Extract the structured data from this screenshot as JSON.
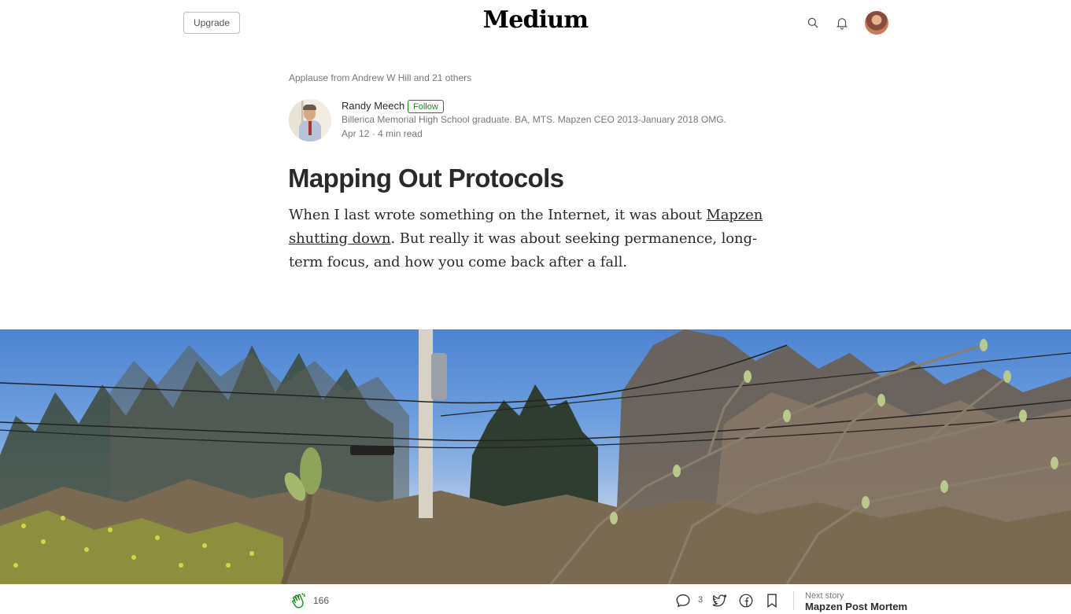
{
  "header": {
    "upgrade_label": "Upgrade",
    "logo_text": "Medium",
    "icons": [
      "search-icon",
      "bell-icon",
      "user-avatar"
    ]
  },
  "article": {
    "applause_text": "Applause from Andrew W Hill and 21 others",
    "author": {
      "name": "Randy Meech",
      "follow_label": "Follow",
      "bio": "Billerica Memorial High School graduate. BA, MTS. Mapzen CEO 2013-January 2018 OMG.",
      "date": "Apr 12",
      "separator": "·",
      "read_time": "4 min read"
    },
    "title": "Mapping Out Protocols",
    "body": {
      "part1": "When I last wrote something on the Internet, it was about ",
      "link_text": "Mapzen shutting down",
      "part2": ". But really it was about seeking permanence, long-term focus, and how you come back after a fall."
    }
  },
  "footer": {
    "clap_count": "166",
    "response_count": "3",
    "next_story_label": "Next story",
    "next_story_title": "Mapzen Post Mortem"
  },
  "colors": {
    "accent_green": "#1a8917",
    "text_primary": "#292929",
    "text_secondary": "#757575"
  }
}
